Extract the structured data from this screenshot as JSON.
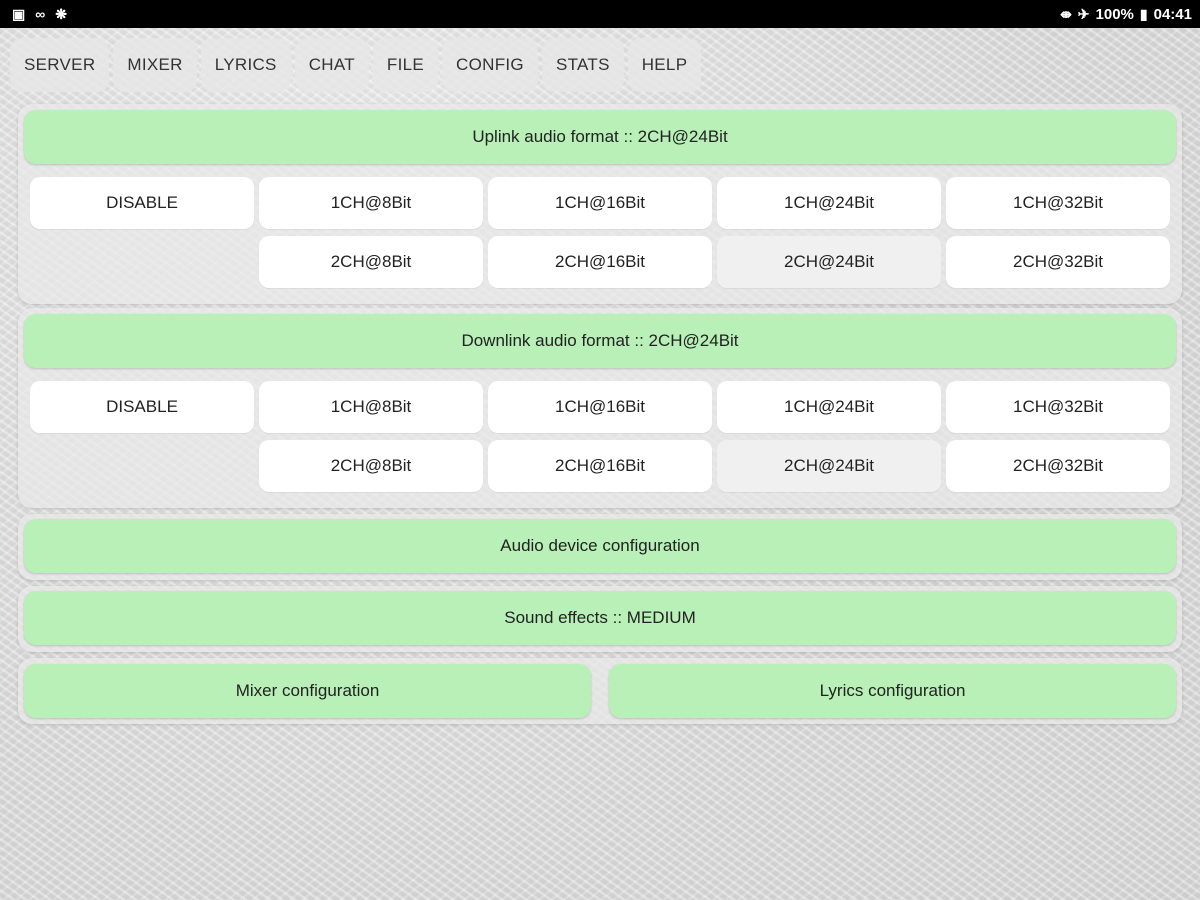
{
  "status_bar": {
    "left_icons": [
      "image-icon",
      "link-icon",
      "settings-icon"
    ],
    "battery": "100%",
    "time": "04:41"
  },
  "tabs": [
    {
      "label": "SERVER"
    },
    {
      "label": "MIXER"
    },
    {
      "label": "LYRICS"
    },
    {
      "label": "CHAT"
    },
    {
      "label": "FILE"
    },
    {
      "label": "CONFIG"
    },
    {
      "label": "STATS"
    },
    {
      "label": "HELP"
    }
  ],
  "uplink": {
    "title": "Uplink audio format :: 2CH@24Bit",
    "disable": "DISABLE",
    "row1": [
      "1CH@8Bit",
      "1CH@16Bit",
      "1CH@24Bit",
      "1CH@32Bit"
    ],
    "row2": [
      "2CH@8Bit",
      "2CH@16Bit",
      "2CH@24Bit",
      "2CH@32Bit"
    ],
    "selected": "2CH@24Bit"
  },
  "downlink": {
    "title": "Downlink audio format :: 2CH@24Bit",
    "disable": "DISABLE",
    "row1": [
      "1CH@8Bit",
      "1CH@16Bit",
      "1CH@24Bit",
      "1CH@32Bit"
    ],
    "row2": [
      "2CH@8Bit",
      "2CH@16Bit",
      "2CH@24Bit",
      "2CH@32Bit"
    ],
    "selected": "2CH@24Bit"
  },
  "buttons": {
    "audio_device": "Audio device configuration",
    "sound_effects": "Sound effects :: MEDIUM",
    "mixer_config": "Mixer configuration",
    "lyrics_config": "Lyrics configuration"
  },
  "colors": {
    "accent_green": "#b8f0b8",
    "status_bar": "#000000"
  }
}
